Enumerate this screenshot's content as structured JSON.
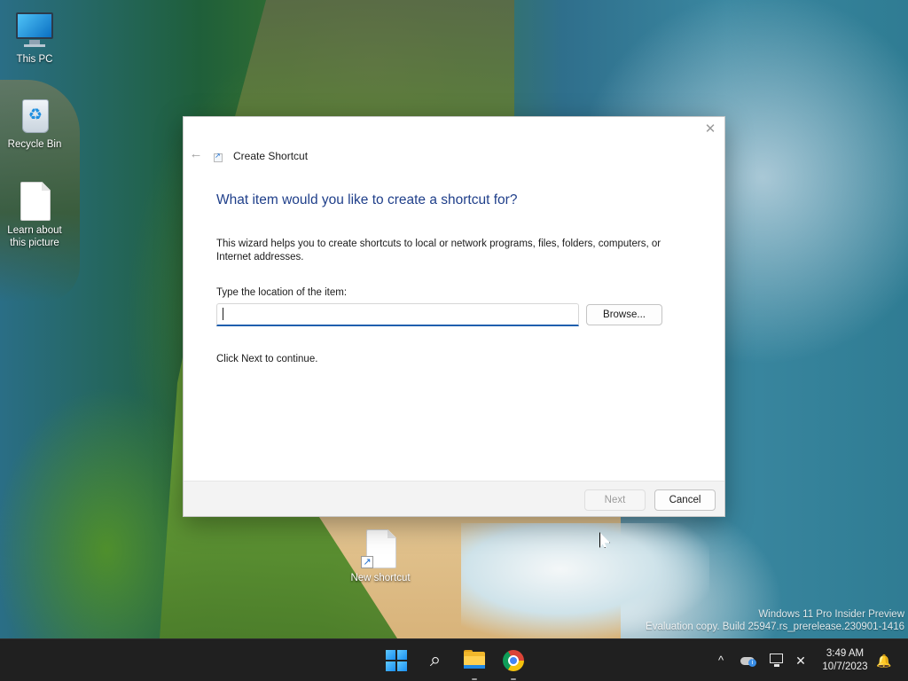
{
  "desktop": {
    "icons": [
      {
        "label_line1": "This PC",
        "label_line2": "",
        "icon": "monitor-icon"
      },
      {
        "label_line1": "Recycle Bin",
        "label_line2": "",
        "icon": "recycle-bin-icon"
      },
      {
        "label_line1": "Learn about",
        "label_line2": "this picture",
        "icon": "document-icon"
      },
      {
        "label_line1": "New shortcut",
        "label_line2": "",
        "icon": "shortcut-icon"
      }
    ],
    "watermark": {
      "line1": "Windows 11 Pro Insider Preview",
      "line2": "Evaluation copy. Build 25947.rs_prerelease.230901-1416"
    }
  },
  "dialog": {
    "title": "Create Shortcut",
    "close_glyph": "✕",
    "back_glyph": "←",
    "heading": "What item would you like to create a shortcut for?",
    "description": "This wizard helps you to create shortcuts to local or network programs, files, folders, computers, or Internet addresses.",
    "location_label": "Type the location of the item:",
    "location_value": "",
    "browse_label": "Browse...",
    "continue_text": "Click Next to continue.",
    "next_label": "Next",
    "cancel_label": "Cancel",
    "next_enabled": false
  },
  "taskbar": {
    "apps": [
      "start",
      "search",
      "file-explorer",
      "chrome"
    ],
    "search_glyph": "⌕",
    "tray": {
      "chevron_glyph": "^",
      "volume_glyph": "✕",
      "bell_glyph": "🔔",
      "time": "3:49 AM",
      "date": "10/7/2023"
    }
  },
  "colors": {
    "heading": "#1f3f8a",
    "input_accent": "#1f5fae",
    "taskbar": "#202020"
  }
}
